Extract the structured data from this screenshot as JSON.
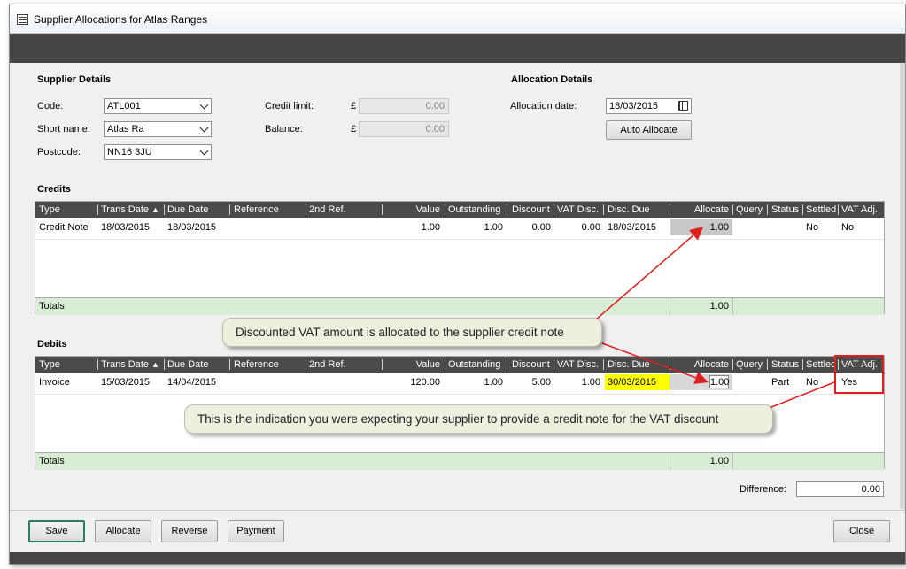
{
  "window": {
    "title": "Supplier Allocations for Atlas Ranges"
  },
  "supplier": {
    "heading": "Supplier Details",
    "code_label": "Code:",
    "code_value": "ATL001",
    "short_label": "Short name:",
    "short_value": "Atlas Ra",
    "postcode_label": "Postcode:",
    "postcode_value": "NN16 3JU",
    "credit_label": "Credit limit:",
    "credit_currency": "£",
    "credit_value": "0.00",
    "balance_label": "Balance:",
    "balance_currency": "£",
    "balance_value": "0.00"
  },
  "allocation": {
    "heading": "Allocation Details",
    "date_label": "Allocation date:",
    "date_value": "18/03/2015",
    "auto_button": "Auto Allocate"
  },
  "columns": [
    "Type",
    "Trans Date",
    "Due Date",
    "Reference",
    "2nd Ref.",
    "Value",
    "Outstanding",
    "Discount",
    "VAT Disc.",
    "Disc. Due",
    "Allocate",
    "Query",
    "Status",
    "Settled",
    "VAT Adj."
  ],
  "credits": {
    "heading": "Credits",
    "row": {
      "type": "Credit Note",
      "trans_date": "18/03/2015",
      "due_date": "18/03/2015",
      "reference": "",
      "ref2": "",
      "value": "1.00",
      "outstanding": "1.00",
      "discount": "0.00",
      "vat_disc": "0.00",
      "disc_due": "18/03/2015",
      "allocate": "1.00",
      "query": "",
      "status": "",
      "settled": "No",
      "vat_adj": "No"
    },
    "totals_label": "Totals",
    "totals_value": "1.00"
  },
  "debits": {
    "heading": "Debits",
    "row": {
      "type": "Invoice",
      "trans_date": "15/03/2015",
      "due_date": "14/04/2015",
      "reference": "",
      "ref2": "",
      "value": "120.00",
      "outstanding": "1.00",
      "discount": "5.00",
      "vat_disc": "1.00",
      "disc_due": "30/03/2015",
      "allocate": "1.00",
      "query": "",
      "status": "Part",
      "settled": "No",
      "vat_adj": "Yes"
    },
    "totals_label": "Totals",
    "totals_value": "1.00"
  },
  "difference": {
    "label": "Difference:",
    "value": "0.00"
  },
  "buttons": {
    "save": "Save",
    "allocate": "Allocate",
    "reverse": "Reverse",
    "payment": "Payment",
    "close": "Close"
  },
  "callouts": {
    "top": "Discounted VAT amount is allocated to the supplier credit note",
    "bottom": "This is the indication you were expecting your supplier to provide a credit note for the VAT discount"
  },
  "colors": {
    "header": "#4a4a4a",
    "totals": "#d9ecd5",
    "highlight_yellow": "#ffff00",
    "annotation_red": "#e02020",
    "save_border": "#2f7d5c"
  }
}
